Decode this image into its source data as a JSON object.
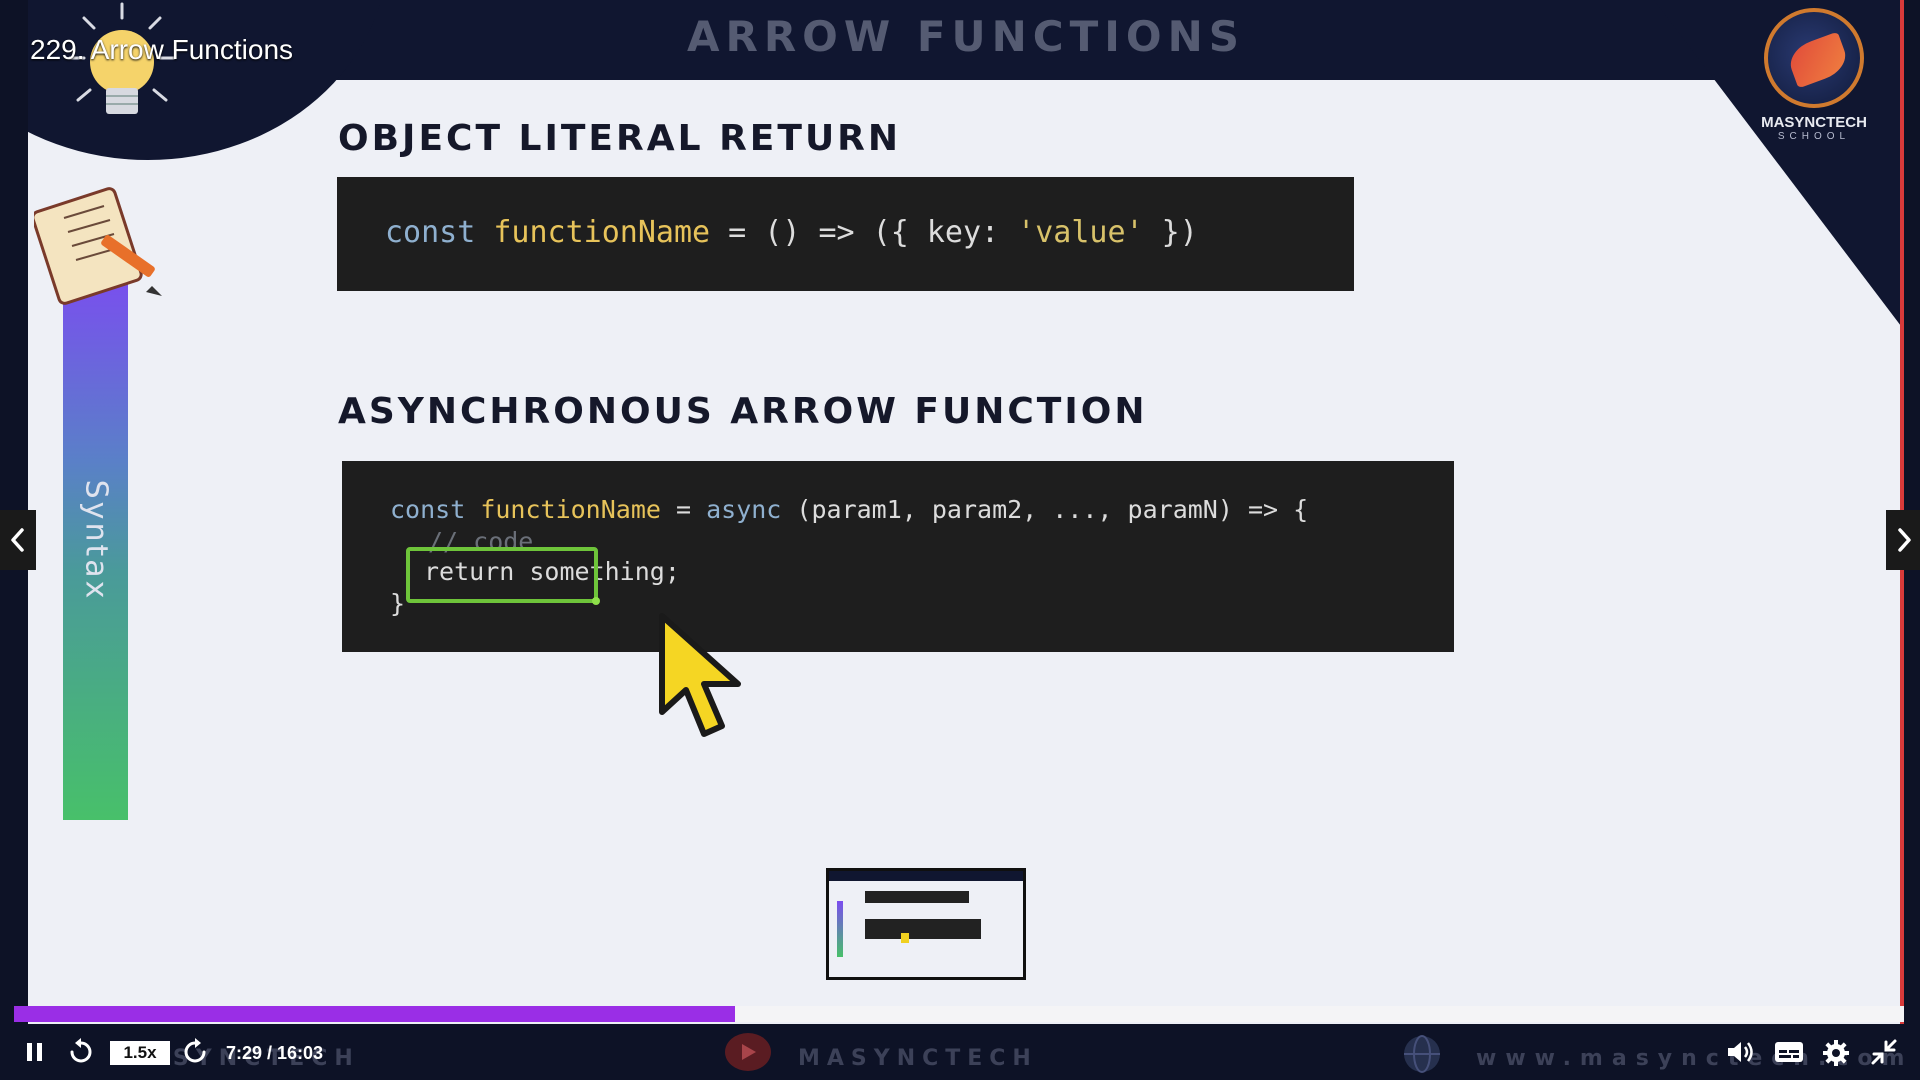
{
  "video": {
    "title": "229. Arrow Functions",
    "progress_fraction": 0.3817,
    "elapsed": "7:29",
    "duration": "16:03",
    "time_display": "7:29 / 16:03",
    "speed": "1.5x"
  },
  "slide": {
    "title": "ARROW FUNCTIONS",
    "sidebar_label": "Syntax",
    "logo_name": "MASYNCTECH",
    "logo_sub": "SCHOOL",
    "section1_heading": "OBJECT LITERAL RETURN",
    "code1": {
      "kw": "const ",
      "fn": "functionName",
      "mid": " = () => ({ key: ",
      "str": "'value'",
      "end": " })"
    },
    "section2_heading": "ASYNCHRONOUS ARROW FUNCTION",
    "code2": {
      "l1_kw": "const ",
      "l1_fn": "functionName",
      "l1_mid": " = ",
      "l1_async": "async",
      "l1_end": " (param1, param2, ..., paramN) => {",
      "l2_comment": "// code",
      "l3": "return something;",
      "l4": "}"
    }
  },
  "watermarks": {
    "left": "MASYNCTECH",
    "center": "MASYNCTECH",
    "right": "www.masynctech.com"
  },
  "icons": [
    "pause-icon",
    "rewind-icon",
    "forward-icon",
    "volume-icon",
    "captions-icon",
    "settings-icon",
    "exit-fullscreen-icon",
    "chevron-left-icon",
    "chevron-right-icon",
    "lightbulb-icon",
    "notebook-icon",
    "cursor-icon"
  ],
  "colors": {
    "progress": "#9a2ee6",
    "code_bg": "#1e1e1e",
    "highlight": "#6ec43a"
  }
}
